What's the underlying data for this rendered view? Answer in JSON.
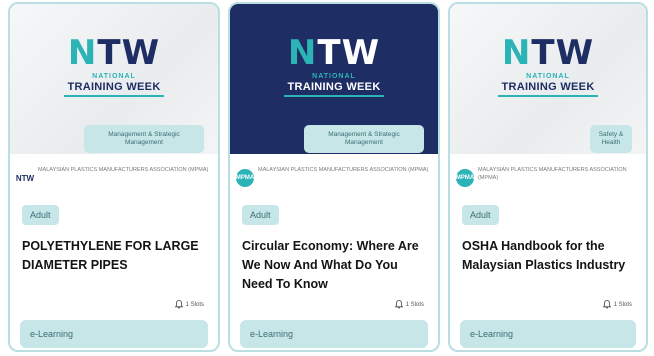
{
  "cards": [
    {
      "logo": {
        "ntw": "NTW",
        "line1": "NATIONAL",
        "line2": "TRAINING WEEK"
      },
      "category": "Management & Strategic Management",
      "org_logo": "NTW",
      "org_name": "MALAYSIAN PLASTICS MANUFACTURERS ASSOCIATION (MPMA)",
      "audience": "Adult",
      "title": "POLYETHYLENE FOR LARGE DIAMETER PIPES",
      "slots": "1 Slots",
      "mode": "e-Learning"
    },
    {
      "logo": {
        "ntw": "NTW",
        "line1": "NATIONAL",
        "line2": "TRAINING WEEK"
      },
      "category": "Management & Strategic Management",
      "org_logo": "MPMA",
      "org_name": "MALAYSIAN PLASTICS MANUFACTURERS ASSOCIATION (MPMA)",
      "audience": "Adult",
      "title": "Circular Economy: Where Are We Now And What Do You Need To Know",
      "slots": "1 Slots",
      "mode": "e-Learning"
    },
    {
      "logo": {
        "ntw": "NTW",
        "line1": "NATIONAL",
        "line2": "TRAINING WEEK"
      },
      "category": "Safety & Health",
      "org_logo": "MPMA",
      "org_name": "MALAYSIAN PLASTICS MANUFACTURERS ASSOCIATION (MPMA)",
      "audience": "Adult",
      "title": "OSHA Handbook for the Malaysian Plastics Industry",
      "slots": "1 Slots",
      "mode": "e-Learning"
    }
  ],
  "colors": {
    "accent": "#2bb3b6",
    "navy": "#1e2d63",
    "chip": "#c7e6e8",
    "border": "#b9dfe2"
  },
  "icons": {
    "slots": "bell-icon"
  }
}
